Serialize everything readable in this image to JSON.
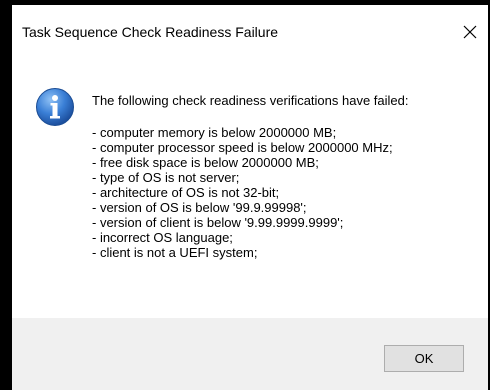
{
  "window": {
    "title": "Task Sequence Check Readiness Failure",
    "close_icon": "close-icon"
  },
  "message": {
    "icon": "info-icon",
    "heading": "The following check readiness verifications have failed:",
    "items": [
      "- computer memory is below 2000000 MB;",
      "- computer processor speed is below 2000000 MHz;",
      "- free disk space is below 2000000 MB;",
      "- type of OS is not server;",
      "- architecture of OS is not 32-bit;",
      "- version of OS is below '99.9.99998';",
      "- version of client is below '9.99.9999.9999';",
      "- incorrect OS language;",
      "- client is not a UEFI system;"
    ]
  },
  "footer": {
    "ok_label": "OK"
  },
  "colors": {
    "background": "#000000",
    "dialog": "#ffffff",
    "footer": "#f0f0f0",
    "button": "#e1e1e1",
    "button_border": "#adadad",
    "info_blue": "#2f6fc6"
  }
}
